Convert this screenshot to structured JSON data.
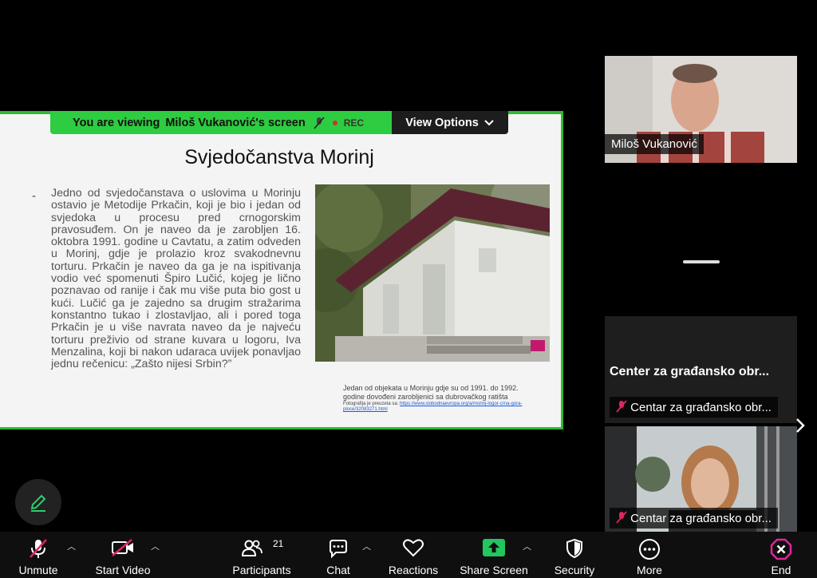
{
  "banner": {
    "viewing_prefix": "You are viewing",
    "presenter_screen": "Miloš Vukanović's screen",
    "rec_label": "REC",
    "view_options_label": "View Options"
  },
  "slide": {
    "title": "Svjedočanstva Morinj",
    "bullet": "-",
    "body": "Jedno od svjedočanstava o uslovima u Morinju ostavio je Metodije Prkačin, koji je bio i jedan od svjedoka u procesu pred crnogorskim pravosuđem. On je naveo da je zarobljen 16. oktobra 1991. godine u Cavtatu, a zatim odveden u Morinj, gdje je prolazio kroz svakodnevnu torturu. Prkačin je naveo da ga je na ispitivanja vodio već spomenuti Špiro Lučić, kojeg je lično poznavao od ranije i čak mu više puta bio gost u kući. Lučić ga je zajedno sa drugim stražarima konstantno tukao i zlostavljao, ali i pored toga Prkačin je u više navrata naveo da je najveću torturu preživio od strane kuvara u logoru, Iva Menzalina, koji bi nakon udaraca uvijek ponavljao jednu rečenicu: „Zašto nijesi Srbin?”",
    "photo_caption": "Jedan od objekata u Morinju gdje su od 1991. do 1992. godine dovođeni zarobljenici sa dubrovačkog ratišta",
    "photo_source_prefix": "Fotografija je preuzeta sa:",
    "photo_source_link": "https://www.slobodnaevropa.org/a/morinj-logor-crna-gora-ploce/32083271.html"
  },
  "participants_tiles": {
    "milos_name": "Miloš Vukanović",
    "center_title": "Center za građansko obr...",
    "center_tag": "Centar za građansko obr...",
    "woman_tag": "Centar za građansko obr..."
  },
  "toolbar": {
    "unmute": "Unmute",
    "start_video": "Start Video",
    "participants": "Participants",
    "participants_count": "21",
    "chat": "Chat",
    "reactions": "Reactions",
    "share_screen": "Share Screen",
    "security": "Security",
    "more": "More",
    "end": "End"
  },
  "colors": {
    "share_green": "#2dbb2d",
    "banner_green": "#2ecc40",
    "mute_red": "#e0245e",
    "end_magenta": "#e0249a",
    "toolbar_bg": "#0f0f0f"
  },
  "icons": [
    "mic-off-icon",
    "video-off-icon",
    "participants-icon",
    "chat-icon",
    "reactions-heart-icon",
    "share-screen-icon",
    "security-shield-icon",
    "more-dots-icon",
    "end-icon",
    "pen-icon",
    "chevron-down-icon",
    "chevron-right-icon"
  ]
}
